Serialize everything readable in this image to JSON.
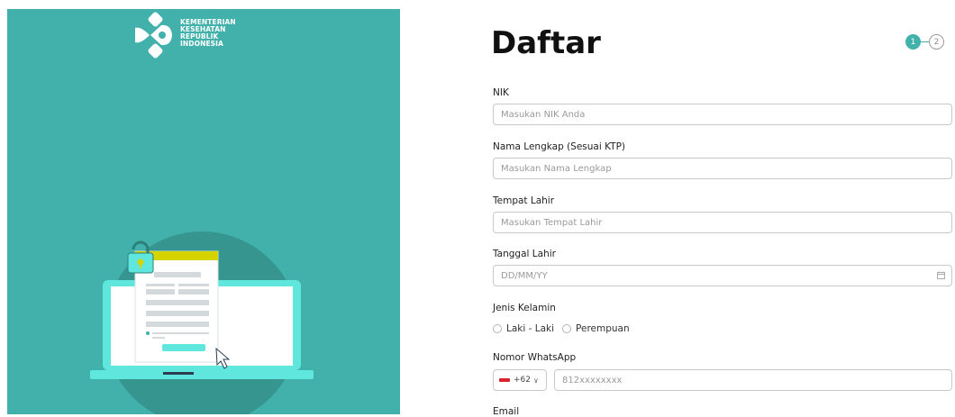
{
  "brand": {
    "lines": [
      "KEMENTERIAN",
      "KESEHATAN",
      "REPUBLIK",
      "INDONESIA"
    ]
  },
  "colors": {
    "accent": "#43b1ab",
    "illustration_yellow": "#d6d400",
    "illustration_teal": "#5fe7dd"
  },
  "form": {
    "title": "Daftar",
    "steps": [
      {
        "label": "1",
        "active": true
      },
      {
        "label": "2",
        "active": false
      }
    ],
    "nik": {
      "label": "NIK",
      "placeholder": "Masukan NIK Anda"
    },
    "nama": {
      "label": "Nama Lengkap (Sesuai KTP)",
      "placeholder": "Masukan Nama Lengkap"
    },
    "tempat": {
      "label": "Tempat Lahir",
      "placeholder": "Masukan Tempat Lahir"
    },
    "tanggal": {
      "label": "Tanggal Lahir",
      "placeholder": "DD/MM/YY",
      "icon": "calendar-icon"
    },
    "gender": {
      "label": "Jenis Kelamin",
      "options": [
        "Laki - Laki",
        "Perempuan"
      ]
    },
    "whatsapp": {
      "label": "Nomor WhatsApp",
      "country_code": "+62",
      "placeholder": "812xxxxxxxx",
      "flag": "indonesia-flag-icon"
    },
    "email": {
      "label": "Email"
    }
  }
}
